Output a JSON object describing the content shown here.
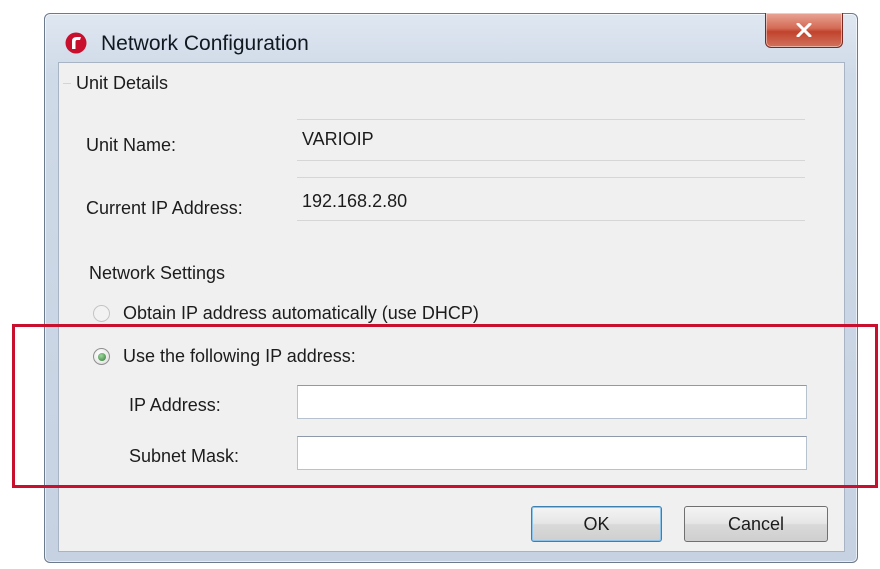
{
  "window": {
    "title": "Network Configuration",
    "close_icon": "close-icon",
    "accent_color": "#c8102e"
  },
  "unit_details": {
    "heading": "Unit Details",
    "name_label": "Unit Name:",
    "name_value": "VARIOIP",
    "ip_label": "Current IP Address:",
    "ip_value": "192.168.2.80"
  },
  "network_settings": {
    "heading": "Network Settings",
    "dhcp_label": "Obtain IP address automatically (use DHCP)",
    "dhcp_checked": false,
    "static_label": "Use the following IP address:",
    "static_checked": true,
    "ip_address_label": "IP Address:",
    "ip_address_value": "",
    "subnet_label": "Subnet Mask:",
    "subnet_value": ""
  },
  "buttons": {
    "ok": "OK",
    "cancel": "Cancel"
  }
}
